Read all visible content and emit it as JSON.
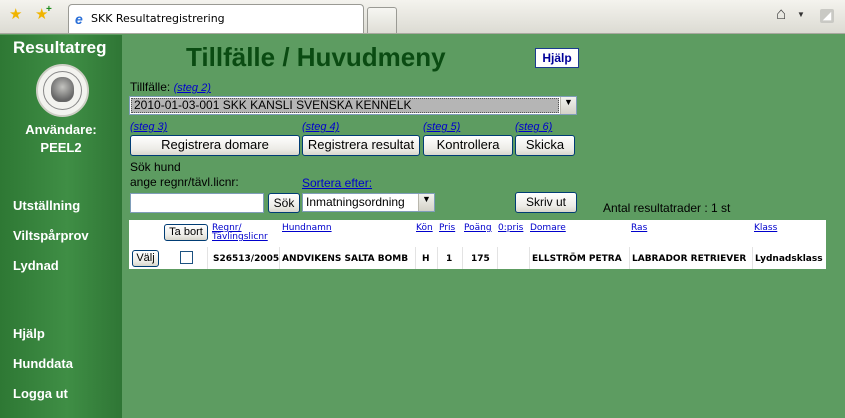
{
  "browser": {
    "tab_title": "SKK Resultatregistrering"
  },
  "sidebar": {
    "title": "Resultatreg",
    "user_label": "Användare:",
    "user_name": "PEEL2",
    "nav_top": [
      "Utställning",
      "Viltspårprov",
      "Lydnad"
    ],
    "nav_bottom": [
      "Hjälp",
      "Hunddata",
      "Logga ut"
    ]
  },
  "header": {
    "title": "Tillfälle / Huvudmeny",
    "help_label": "Hjälp"
  },
  "occasion": {
    "label": "Tillfälle:",
    "step": "(steg 2)",
    "selected": "2010-01-03-001 SKK KANSLI SVENSKA KENNELK"
  },
  "actions": [
    {
      "step": "(steg 3)",
      "label": "Registrera domare"
    },
    {
      "step": "(steg 4)",
      "label": "Registrera resultat"
    },
    {
      "step": "(steg 5)",
      "label": "Kontrollera"
    },
    {
      "step": "(steg 6)",
      "label": "Skicka"
    }
  ],
  "search": {
    "label_line1": "Sök hund",
    "label_line2": "ange regnr/tävl.licnr:",
    "value": "",
    "button": "Sök",
    "sort_label": "Sortera efter:",
    "sort_selected": "Inmatningsordning",
    "print_button": "Skriv ut",
    "count_text": "Antal resultatrader : 1 st"
  },
  "table": {
    "delete_button": "Ta bort",
    "headers": {
      "regnr_line1": "Regnr/",
      "regnr_line2": "Tävlingslicnr",
      "name": "Hundnamn",
      "sex": "Kön",
      "prize": "Pris",
      "points": "Poäng",
      "zero_prize": "0:pris",
      "judge": "Domare",
      "breed": "Ras",
      "class": "Klass"
    },
    "rows": [
      {
        "select": "Välj",
        "regnr": "S26513/2005",
        "name": "ANDVIKENS SALTA BOMB",
        "sex": "H",
        "prize": "1",
        "points": "175",
        "zero_prize": "",
        "judge": "ELLSTRÖM PETRA",
        "breed": "LABRADOR RETRIEVER",
        "class": "Lydnadsklass I"
      }
    ]
  }
}
